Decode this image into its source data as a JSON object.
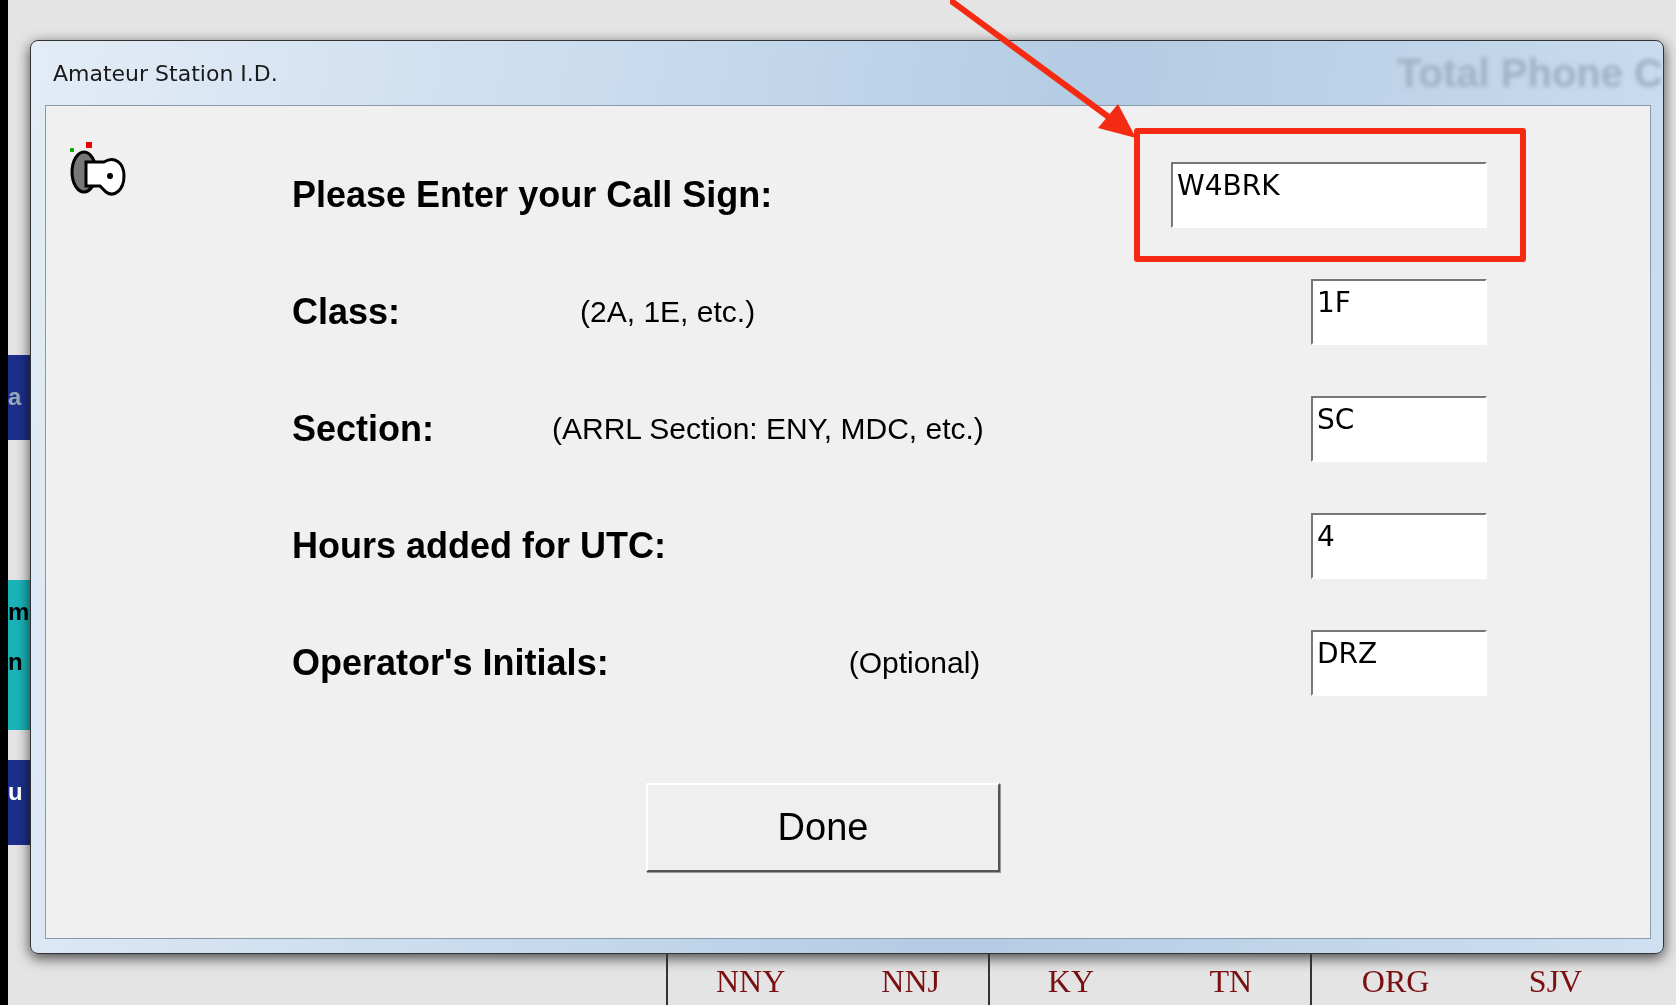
{
  "background_window": {
    "title": "Total Phone C",
    "edge_fragments": [
      {
        "text": "a",
        "color": "#1c2f8c"
      },
      {
        "text": "m",
        "color": "#19b3b8"
      },
      {
        "text": "n",
        "color": "#19b3b8"
      },
      {
        "text": "u",
        "color": "#1c2f8c"
      }
    ],
    "section_groups": [
      [
        "NNY",
        "NNJ"
      ],
      [
        "KY",
        "TN"
      ],
      [
        "ORG",
        "SJV"
      ]
    ]
  },
  "dialog": {
    "title": "Amateur Station I.D.",
    "fields": [
      {
        "label": "Please Enter your Call Sign:",
        "value": "W4BRK",
        "highlighted": true
      },
      {
        "label": "Class:",
        "hint": "(2A, 1E, etc.)",
        "value": "1F",
        "highlighted": false
      },
      {
        "label": "Section:",
        "hint": "(ARRL Section: ENY, MDC, etc.)",
        "value": "SC",
        "highlighted": false
      },
      {
        "label": "Hours added for UTC:",
        "value": "4",
        "highlighted": false
      },
      {
        "label": "Operator's Initials:",
        "hint": "(Optional)",
        "value": "DRZ",
        "highlighted": false
      }
    ],
    "button": "Done"
  }
}
